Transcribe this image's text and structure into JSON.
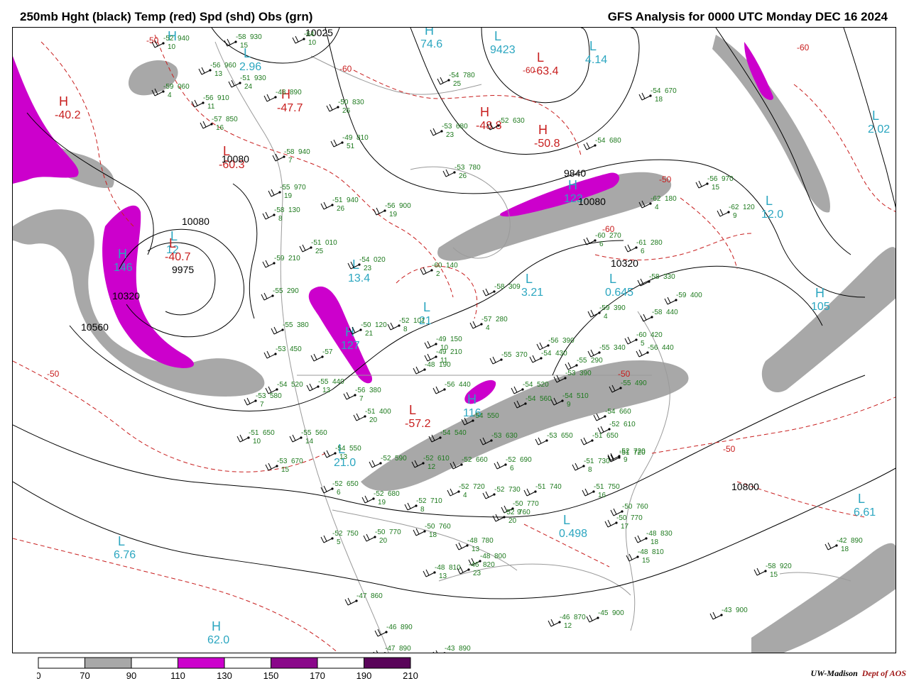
{
  "header": {
    "left_title": "250mb Hght (black) Temp (red) Spd (shd) Obs (grn)",
    "right_title": "GFS Analysis for 0000 UTC Monday  DEC 16 2024"
  },
  "colors": {
    "height": "#000000",
    "temp": "#c81e1e",
    "obs": "#1e7a1e",
    "system": "#2ba6c0",
    "coast": "#9a9a9a",
    "speed_70": "#a8a8a8",
    "speed_110": "#cc00cc",
    "speed_150": "#8a088a",
    "speed_190": "#5a045a"
  },
  "colorbar": {
    "labels": [
      "0",
      "70",
      "90",
      "110",
      "130",
      "150",
      "170",
      "190",
      "210"
    ],
    "fills": [
      "#ffffff",
      "#a8a8a8",
      "#ffffff",
      "#cc00cc",
      "#ffffff",
      "#8a088a",
      "#ffffff",
      "#5a045a"
    ]
  },
  "height_labels": [
    {
      "text": "10025"
    },
    {
      "text": "10080"
    },
    {
      "text": "10080"
    },
    {
      "text": "9975"
    },
    {
      "text": "10320"
    },
    {
      "text": "10560"
    },
    {
      "text": "9840"
    },
    {
      "text": "10080"
    },
    {
      "text": "10320"
    },
    {
      "text": "10800"
    }
  ],
  "temp_labels": [
    {
      "text": "-50"
    },
    {
      "text": "-50"
    },
    {
      "text": "-60"
    },
    {
      "text": "-60"
    },
    {
      "text": "-60"
    },
    {
      "text": "-60"
    },
    {
      "text": "-50"
    },
    {
      "text": "-50"
    },
    {
      "text": "-50"
    }
  ],
  "systems": [
    {
      "letter": "H",
      "value": "",
      "kind": "cyan"
    },
    {
      "letter": "L",
      "value": "2.96",
      "kind": "cyan"
    },
    {
      "letter": "H",
      "value": "74.6",
      "kind": "cyan"
    },
    {
      "letter": "L",
      "value": "9423",
      "kind": "cyan"
    },
    {
      "letter": "L",
      "value": "4.14",
      "kind": "cyan"
    },
    {
      "letter": "L",
      "value": "2.02",
      "kind": "cyan"
    },
    {
      "letter": "H",
      "value": "146",
      "kind": "cyan"
    },
    {
      "letter": "L",
      "value": "12",
      "kind": "cyan"
    },
    {
      "letter": "H",
      "value": "123",
      "kind": "cyan"
    },
    {
      "letter": "L",
      "value": "12.0",
      "kind": "cyan"
    },
    {
      "letter": "L",
      "value": "13.4",
      "kind": "cyan"
    },
    {
      "letter": "L",
      "value": "21",
      "kind": "cyan"
    },
    {
      "letter": "L",
      "value": "3.21",
      "kind": "cyan"
    },
    {
      "letter": "L",
      "value": "0.645",
      "kind": "cyan"
    },
    {
      "letter": "H",
      "value": "105",
      "kind": "cyan"
    },
    {
      "letter": "H",
      "value": "127",
      "kind": "cyan"
    },
    {
      "letter": "H",
      "value": "116",
      "kind": "cyan"
    },
    {
      "letter": "L",
      "value": "21.0",
      "kind": "cyan"
    },
    {
      "letter": "L",
      "value": "0.498",
      "kind": "cyan"
    },
    {
      "letter": "L",
      "value": "6.61",
      "kind": "cyan"
    },
    {
      "letter": "L",
      "value": "6.76",
      "kind": "cyan"
    },
    {
      "letter": "H",
      "value": "62.0",
      "kind": "cyan"
    },
    {
      "letter": "H",
      "value": "-40.2",
      "kind": "red"
    },
    {
      "letter": "L",
      "value": "-60.3",
      "kind": "red"
    },
    {
      "letter": "H",
      "value": "-48.8",
      "kind": "red"
    },
    {
      "letter": "H",
      "value": "-50.8",
      "kind": "red"
    },
    {
      "letter": "L",
      "value": "-63.4",
      "kind": "red"
    },
    {
      "letter": "L",
      "value": "-40.7",
      "kind": "red"
    },
    {
      "letter": "L",
      "value": "-57.2",
      "kind": "red"
    },
    {
      "letter": "H",
      "value": "-47.7",
      "kind": "red"
    }
  ],
  "observations": [
    {
      "t": "-52",
      "h": "940",
      "s": "10"
    },
    {
      "t": "-58",
      "h": "930",
      "s": "15"
    },
    {
      "t": "-64",
      "h": "",
      "s": "10"
    },
    {
      "t": "-56",
      "h": "960",
      "s": "13"
    },
    {
      "t": "-51",
      "h": "930",
      "s": "24"
    },
    {
      "t": "-59",
      "h": "060",
      "s": "4"
    },
    {
      "t": "-56",
      "h": "910",
      "s": "11"
    },
    {
      "t": "-48",
      "h": "890",
      "s": ""
    },
    {
      "t": "-57",
      "h": "850",
      "s": "16"
    },
    {
      "t": "-50",
      "h": "830",
      "s": "26"
    },
    {
      "t": "-54",
      "h": "780",
      "s": "25"
    },
    {
      "t": "-53",
      "h": "680",
      "s": "23"
    },
    {
      "t": "-52",
      "h": "630",
      "s": ""
    },
    {
      "t": "-49",
      "h": "810",
      "s": "51"
    },
    {
      "t": "-54",
      "h": "670",
      "s": "18"
    },
    {
      "t": "-54",
      "h": "680",
      "s": ""
    },
    {
      "t": "-53",
      "h": "780",
      "s": "26"
    },
    {
      "t": "-58",
      "h": "940",
      "s": "7"
    },
    {
      "t": "-51",
      "h": "940",
      "s": "26"
    },
    {
      "t": "-56",
      "h": "900",
      "s": "19"
    },
    {
      "t": "-58",
      "h": "130",
      "s": "8"
    },
    {
      "t": "-51",
      "h": "010",
      "s": "25"
    },
    {
      "t": "-54",
      "h": "020",
      "s": "23"
    },
    {
      "t": "-60",
      "h": "140",
      "s": "2"
    },
    {
      "t": "-59",
      "h": "210",
      "s": ""
    },
    {
      "t": "-60",
      "h": "270",
      "s": "6"
    },
    {
      "t": "-61",
      "h": "280",
      "s": "6"
    },
    {
      "t": "-62",
      "h": "180",
      "s": "4"
    },
    {
      "t": "-62",
      "h": "120",
      "s": "9"
    },
    {
      "t": "-58",
      "h": "309",
      "s": ""
    },
    {
      "t": "-57",
      "h": "280",
      "s": "4"
    },
    {
      "t": "-59",
      "h": "390",
      "s": "4"
    },
    {
      "t": "-58",
      "h": "330",
      "s": ""
    },
    {
      "t": "-59",
      "h": "400",
      "s": ""
    },
    {
      "t": "-58",
      "h": "440",
      "s": ""
    },
    {
      "t": "-60",
      "h": "420",
      "s": "5"
    },
    {
      "t": "-56",
      "h": "440",
      "s": ""
    },
    {
      "t": "-55",
      "h": "340",
      "s": ""
    },
    {
      "t": "-50",
      "h": "120",
      "s": "21"
    },
    {
      "t": "-52",
      "h": "101",
      "s": "8"
    },
    {
      "t": "-49",
      "h": "150",
      "s": "10"
    },
    {
      "t": "-49",
      "h": "210",
      "s": "11"
    },
    {
      "t": "-55",
      "h": "370",
      "s": ""
    },
    {
      "t": "-48",
      "h": "190",
      "s": ""
    },
    {
      "t": "-56",
      "h": "390",
      "s": ""
    },
    {
      "t": "-54",
      "h": "430",
      "s": ""
    },
    {
      "t": "-55",
      "h": "290",
      "s": ""
    },
    {
      "t": "-53",
      "h": "390",
      "s": ""
    },
    {
      "t": "-55",
      "h": "490",
      "s": ""
    },
    {
      "t": "-54",
      "h": "510",
      "s": "9"
    },
    {
      "t": "-54",
      "h": "560",
      "s": ""
    },
    {
      "t": "-54",
      "h": "520",
      "s": ""
    },
    {
      "t": "-54",
      "h": "550",
      "s": ""
    },
    {
      "t": "-54",
      "h": "660",
      "s": ""
    },
    {
      "t": "-52",
      "h": "610",
      "s": ""
    },
    {
      "t": "-51",
      "h": "650",
      "s": ""
    },
    {
      "t": "-55",
      "h": "380",
      "s": ""
    },
    {
      "t": "-55",
      "h": "290",
      "s": ""
    },
    {
      "t": "-53",
      "h": "450",
      "s": ""
    },
    {
      "t": "-57",
      "h": "",
      "s": ""
    },
    {
      "t": "-54",
      "h": "520",
      "s": ""
    },
    {
      "t": "-55",
      "h": "440",
      "s": "13"
    },
    {
      "t": "-56",
      "h": "380",
      "s": "7"
    },
    {
      "t": "-53",
      "h": "580",
      "s": "7"
    },
    {
      "t": "-51",
      "h": "400",
      "s": "20"
    },
    {
      "t": "-56",
      "h": "440",
      "s": ""
    },
    {
      "t": "-54",
      "h": "540",
      "s": ""
    },
    {
      "t": "-53",
      "h": "630",
      "s": ""
    },
    {
      "t": "-53",
      "h": "650",
      "s": ""
    },
    {
      "t": "-51",
      "h": "650",
      "s": "10"
    },
    {
      "t": "-55",
      "h": "560",
      "s": "14"
    },
    {
      "t": "-54",
      "h": "550",
      "s": "13"
    },
    {
      "t": "-53",
      "h": "670",
      "s": "15"
    },
    {
      "t": "-52",
      "h": "590",
      "s": ""
    },
    {
      "t": "-52",
      "h": "610",
      "s": "12"
    },
    {
      "t": "-52",
      "h": "660",
      "s": ""
    },
    {
      "t": "-52",
      "h": "690",
      "s": "6"
    },
    {
      "t": "-51",
      "h": "730",
      "s": "8"
    },
    {
      "t": "-51",
      "h": "720",
      "s": ""
    },
    {
      "t": "-52",
      "h": "720",
      "s": "9"
    },
    {
      "t": "-52",
      "h": "650",
      "s": "6"
    },
    {
      "t": "-52",
      "h": "680",
      "s": "19"
    },
    {
      "t": "-52",
      "h": "710",
      "s": "8"
    },
    {
      "t": "-52",
      "h": "720",
      "s": "4"
    },
    {
      "t": "-52",
      "h": "730",
      "s": ""
    },
    {
      "t": "-51",
      "h": "740",
      "s": ""
    },
    {
      "t": "-51",
      "h": "750",
      "s": "16"
    },
    {
      "t": "-52",
      "h": "750",
      "s": "5"
    },
    {
      "t": "-50",
      "h": "760",
      "s": ""
    },
    {
      "t": "-50",
      "h": "770",
      "s": "9"
    },
    {
      "t": "-52",
      "h": "760",
      "s": "20"
    },
    {
      "t": "-50",
      "h": "770",
      "s": "20"
    },
    {
      "t": "-50",
      "h": "760",
      "s": "18"
    },
    {
      "t": "-50",
      "h": "770",
      "s": "17"
    },
    {
      "t": "-48",
      "h": "780",
      "s": "13"
    },
    {
      "t": "-48",
      "h": "800",
      "s": ""
    },
    {
      "t": "-48",
      "h": "830",
      "s": "18"
    },
    {
      "t": "-48",
      "h": "810",
      "s": "15"
    },
    {
      "t": "-48",
      "h": "810",
      "s": "13"
    },
    {
      "t": "-46",
      "h": "820",
      "s": "23"
    },
    {
      "t": "-47",
      "h": "860",
      "s": ""
    },
    {
      "t": "-46",
      "h": "890",
      "s": ""
    },
    {
      "t": "-47",
      "h": "890",
      "s": "18"
    },
    {
      "t": "-46",
      "h": "870",
      "s": "12"
    },
    {
      "t": "-45",
      "h": "900",
      "s": ""
    },
    {
      "t": "-43",
      "h": "890",
      "s": ""
    },
    {
      "t": "-43",
      "h": "900",
      "s": ""
    },
    {
      "t": "-42",
      "h": "890",
      "s": "18"
    },
    {
      "t": "-58",
      "h": "920",
      "s": "15"
    },
    {
      "t": "-56",
      "h": "970",
      "s": "15"
    },
    {
      "t": "-55",
      "h": "970",
      "s": "19"
    }
  ],
  "credit": {
    "a": "UW-Madison",
    "b": "Dept of AOS"
  }
}
